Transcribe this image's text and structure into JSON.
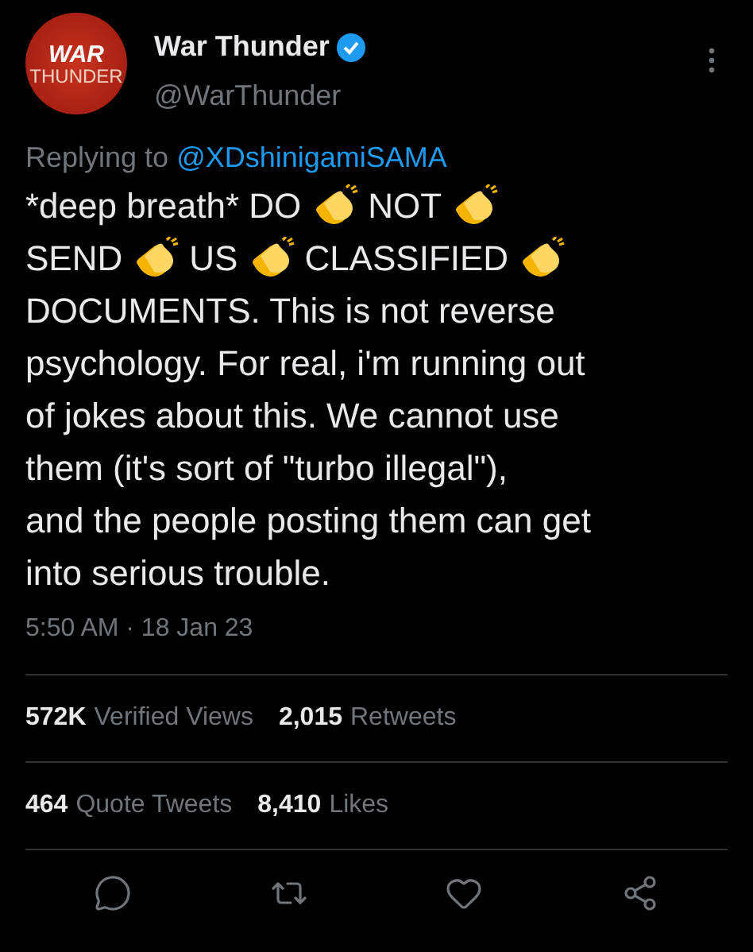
{
  "author": {
    "avatar_text": [
      "WAR",
      "THUNDER"
    ],
    "name": "War Thunder",
    "verified": true,
    "handle": "@WarThunder"
  },
  "reply": {
    "prefix": "Replying to",
    "handle": "@XDshinigamiSAMA"
  },
  "body": [
    [
      {
        "kind": "text",
        "text": "*deep breath* DO"
      },
      {
        "kind": "clap"
      },
      {
        "kind": "text",
        "text": "NOT"
      },
      {
        "kind": "clap"
      }
    ],
    [
      {
        "kind": "text",
        "text": "SEND"
      },
      {
        "kind": "clap"
      },
      {
        "kind": "text",
        "text": "US"
      },
      {
        "kind": "clap"
      },
      {
        "kind": "text",
        "text": "CLASSIFIED"
      },
      {
        "kind": "clap"
      }
    ],
    [
      {
        "kind": "text",
        "text": "DOCUMENTS. This is not reverse"
      }
    ],
    [
      {
        "kind": "text",
        "text": "psychology. For real, i'm running out"
      }
    ],
    [
      {
        "kind": "text",
        "text": "of jokes about this. We cannot use"
      }
    ],
    [
      {
        "kind": "text",
        "text": "them (it's sort of \"turbo illegal\"),"
      }
    ],
    [
      {
        "kind": "text",
        "text": "and the people posting them can get"
      }
    ],
    [
      {
        "kind": "text",
        "text": "into serious trouble."
      }
    ]
  ],
  "timestamp": "5:50 AM · 18 Jan 23",
  "stats": [
    [
      {
        "count": "572K",
        "label": "Verified Views"
      },
      {
        "count": "2,015",
        "label": "Retweets"
      }
    ],
    [
      {
        "count": "464",
        "label": "Quote Tweets"
      },
      {
        "count": "8,410",
        "label": "Likes"
      }
    ]
  ],
  "actions": [
    {
      "kind": "reply"
    },
    {
      "kind": "retweet"
    },
    {
      "kind": "like"
    },
    {
      "kind": "share"
    }
  ]
}
